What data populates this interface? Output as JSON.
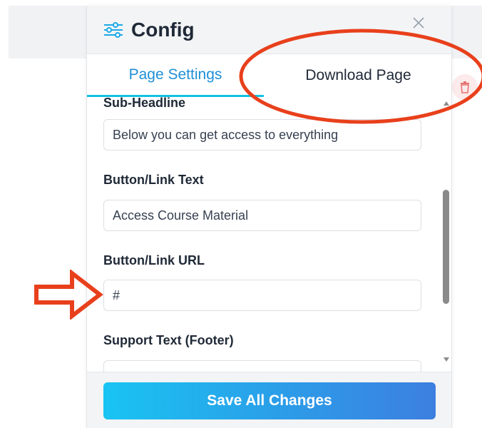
{
  "panel": {
    "title": "Config",
    "header_icon": "sliders-icon",
    "close_icon": "close-icon"
  },
  "tabs": [
    {
      "label": "Page Settings",
      "active": true
    },
    {
      "label": "Download Page",
      "active": false
    }
  ],
  "fields": {
    "sub_headline": {
      "label": "Sub-Headline",
      "value": "Below you can get access to everything"
    },
    "button_text": {
      "label": "Button/Link Text",
      "value": "Access Course Material"
    },
    "button_url": {
      "label": "Button/Link URL",
      "value": "#"
    },
    "support_text": {
      "label": "Support Text (Footer)",
      "value": ""
    }
  },
  "footer": {
    "save_label": "Save All Changes"
  },
  "background": {
    "trash_icon": "trash-icon"
  },
  "colors": {
    "tab_active_text": "#1f8fd6",
    "tab_underline": "#12c2e0",
    "button_gradient_start": "#19c4f2",
    "button_gradient_end": "#3d7fe0",
    "annotation": "#e8401c"
  }
}
